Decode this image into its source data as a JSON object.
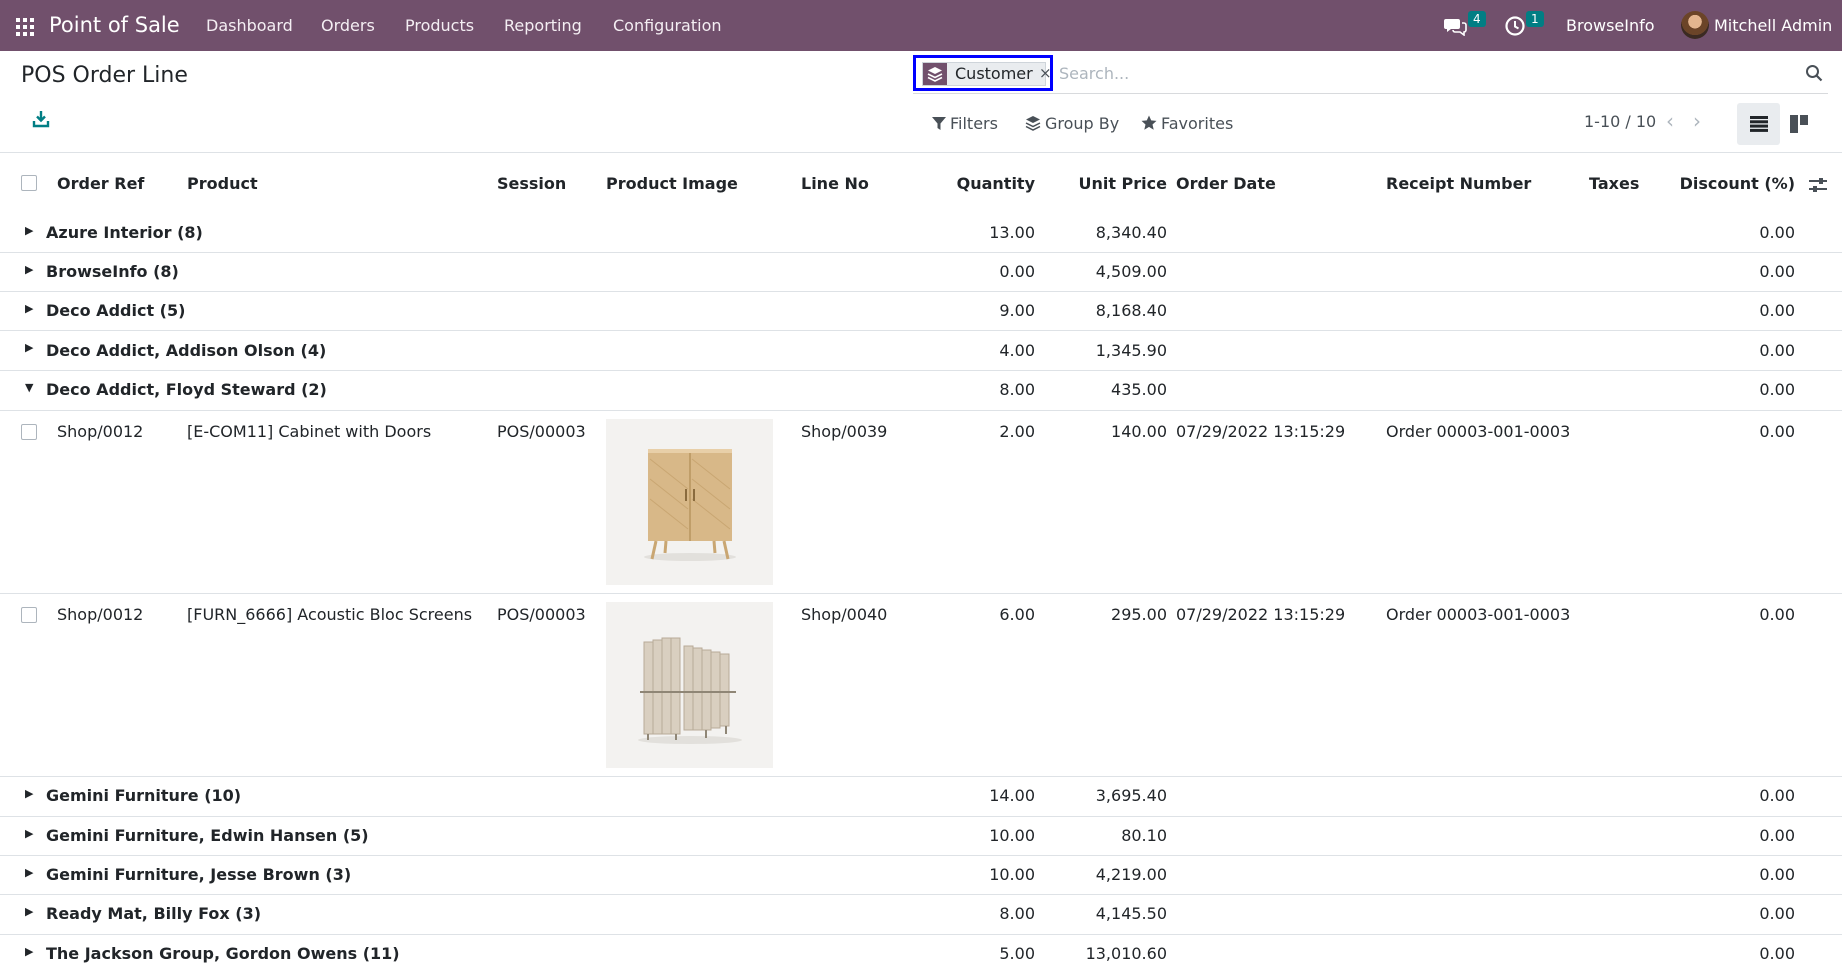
{
  "app": {
    "name": "Point of Sale"
  },
  "nav": {
    "menu": [
      "Dashboard",
      "Orders",
      "Products",
      "Reporting",
      "Configuration"
    ],
    "messages_count": "4",
    "activities_count": "1",
    "company": "BrowseInfo",
    "user": "Mitchell Admin"
  },
  "page": {
    "title": "POS Order Line"
  },
  "search": {
    "facet_label": "Customer",
    "facet_remove": "×",
    "placeholder": "Search..."
  },
  "controls": {
    "filters": "Filters",
    "group_by": "Group By",
    "favorites": "Favorites",
    "pager": "1-10 / 10"
  },
  "colors": {
    "navbar": "#71506c",
    "badge": "#017e84",
    "highlight": "#0000ff"
  },
  "table": {
    "columns": {
      "order_ref": "Order Ref",
      "product": "Product",
      "session": "Session",
      "product_image": "Product Image",
      "line_no": "Line No",
      "quantity": "Quantity",
      "unit_price": "Unit Price",
      "order_date": "Order Date",
      "receipt_number": "Receipt Number",
      "taxes": "Taxes",
      "discount": "Discount (%)"
    },
    "groups": [
      {
        "label": "Azure Interior (8)",
        "quantity": "13.00",
        "unit_price": "8,340.40",
        "discount": "0.00"
      },
      {
        "label": "BrowseInfo (8)",
        "quantity": "0.00",
        "unit_price": "4,509.00",
        "discount": "0.00"
      },
      {
        "label": "Deco Addict (5)",
        "quantity": "9.00",
        "unit_price": "8,168.40",
        "discount": "0.00"
      },
      {
        "label": "Deco Addict, Addison Olson (4)",
        "quantity": "4.00",
        "unit_price": "1,345.90",
        "discount": "0.00"
      },
      {
        "label": "Deco Addict, Floyd Steward (2)",
        "quantity": "8.00",
        "unit_price": "435.00",
        "discount": "0.00"
      },
      {
        "label": "Gemini Furniture (10)",
        "quantity": "14.00",
        "unit_price": "3,695.40",
        "discount": "0.00"
      },
      {
        "label": "Gemini Furniture, Edwin Hansen (5)",
        "quantity": "10.00",
        "unit_price": "80.10",
        "discount": "0.00"
      },
      {
        "label": "Gemini Furniture, Jesse Brown (3)",
        "quantity": "10.00",
        "unit_price": "4,219.00",
        "discount": "0.00"
      },
      {
        "label": "Ready Mat, Billy Fox (3)",
        "quantity": "8.00",
        "unit_price": "4,145.50",
        "discount": "0.00"
      },
      {
        "label": "The Jackson Group, Gordon Owens (11)",
        "quantity": "5.00",
        "unit_price": "13,010.60",
        "discount": "0.00"
      }
    ],
    "lines": [
      {
        "order_ref": "Shop/0012",
        "product": "[E-COM11] Cabinet with Doors",
        "session": "POS/00003",
        "line_no": "Shop/0039",
        "quantity": "2.00",
        "unit_price": "140.00",
        "order_date": "07/29/2022 13:15:29",
        "receipt_number": "Order 00003-001-0003",
        "discount": "0.00"
      },
      {
        "order_ref": "Shop/0012",
        "product": "[FURN_6666] Acoustic Bloc Screens",
        "session": "POS/00003",
        "line_no": "Shop/0040",
        "quantity": "6.00",
        "unit_price": "295.00",
        "order_date": "07/29/2022 13:15:29",
        "receipt_number": "Order 00003-001-0003",
        "discount": "0.00"
      }
    ]
  }
}
